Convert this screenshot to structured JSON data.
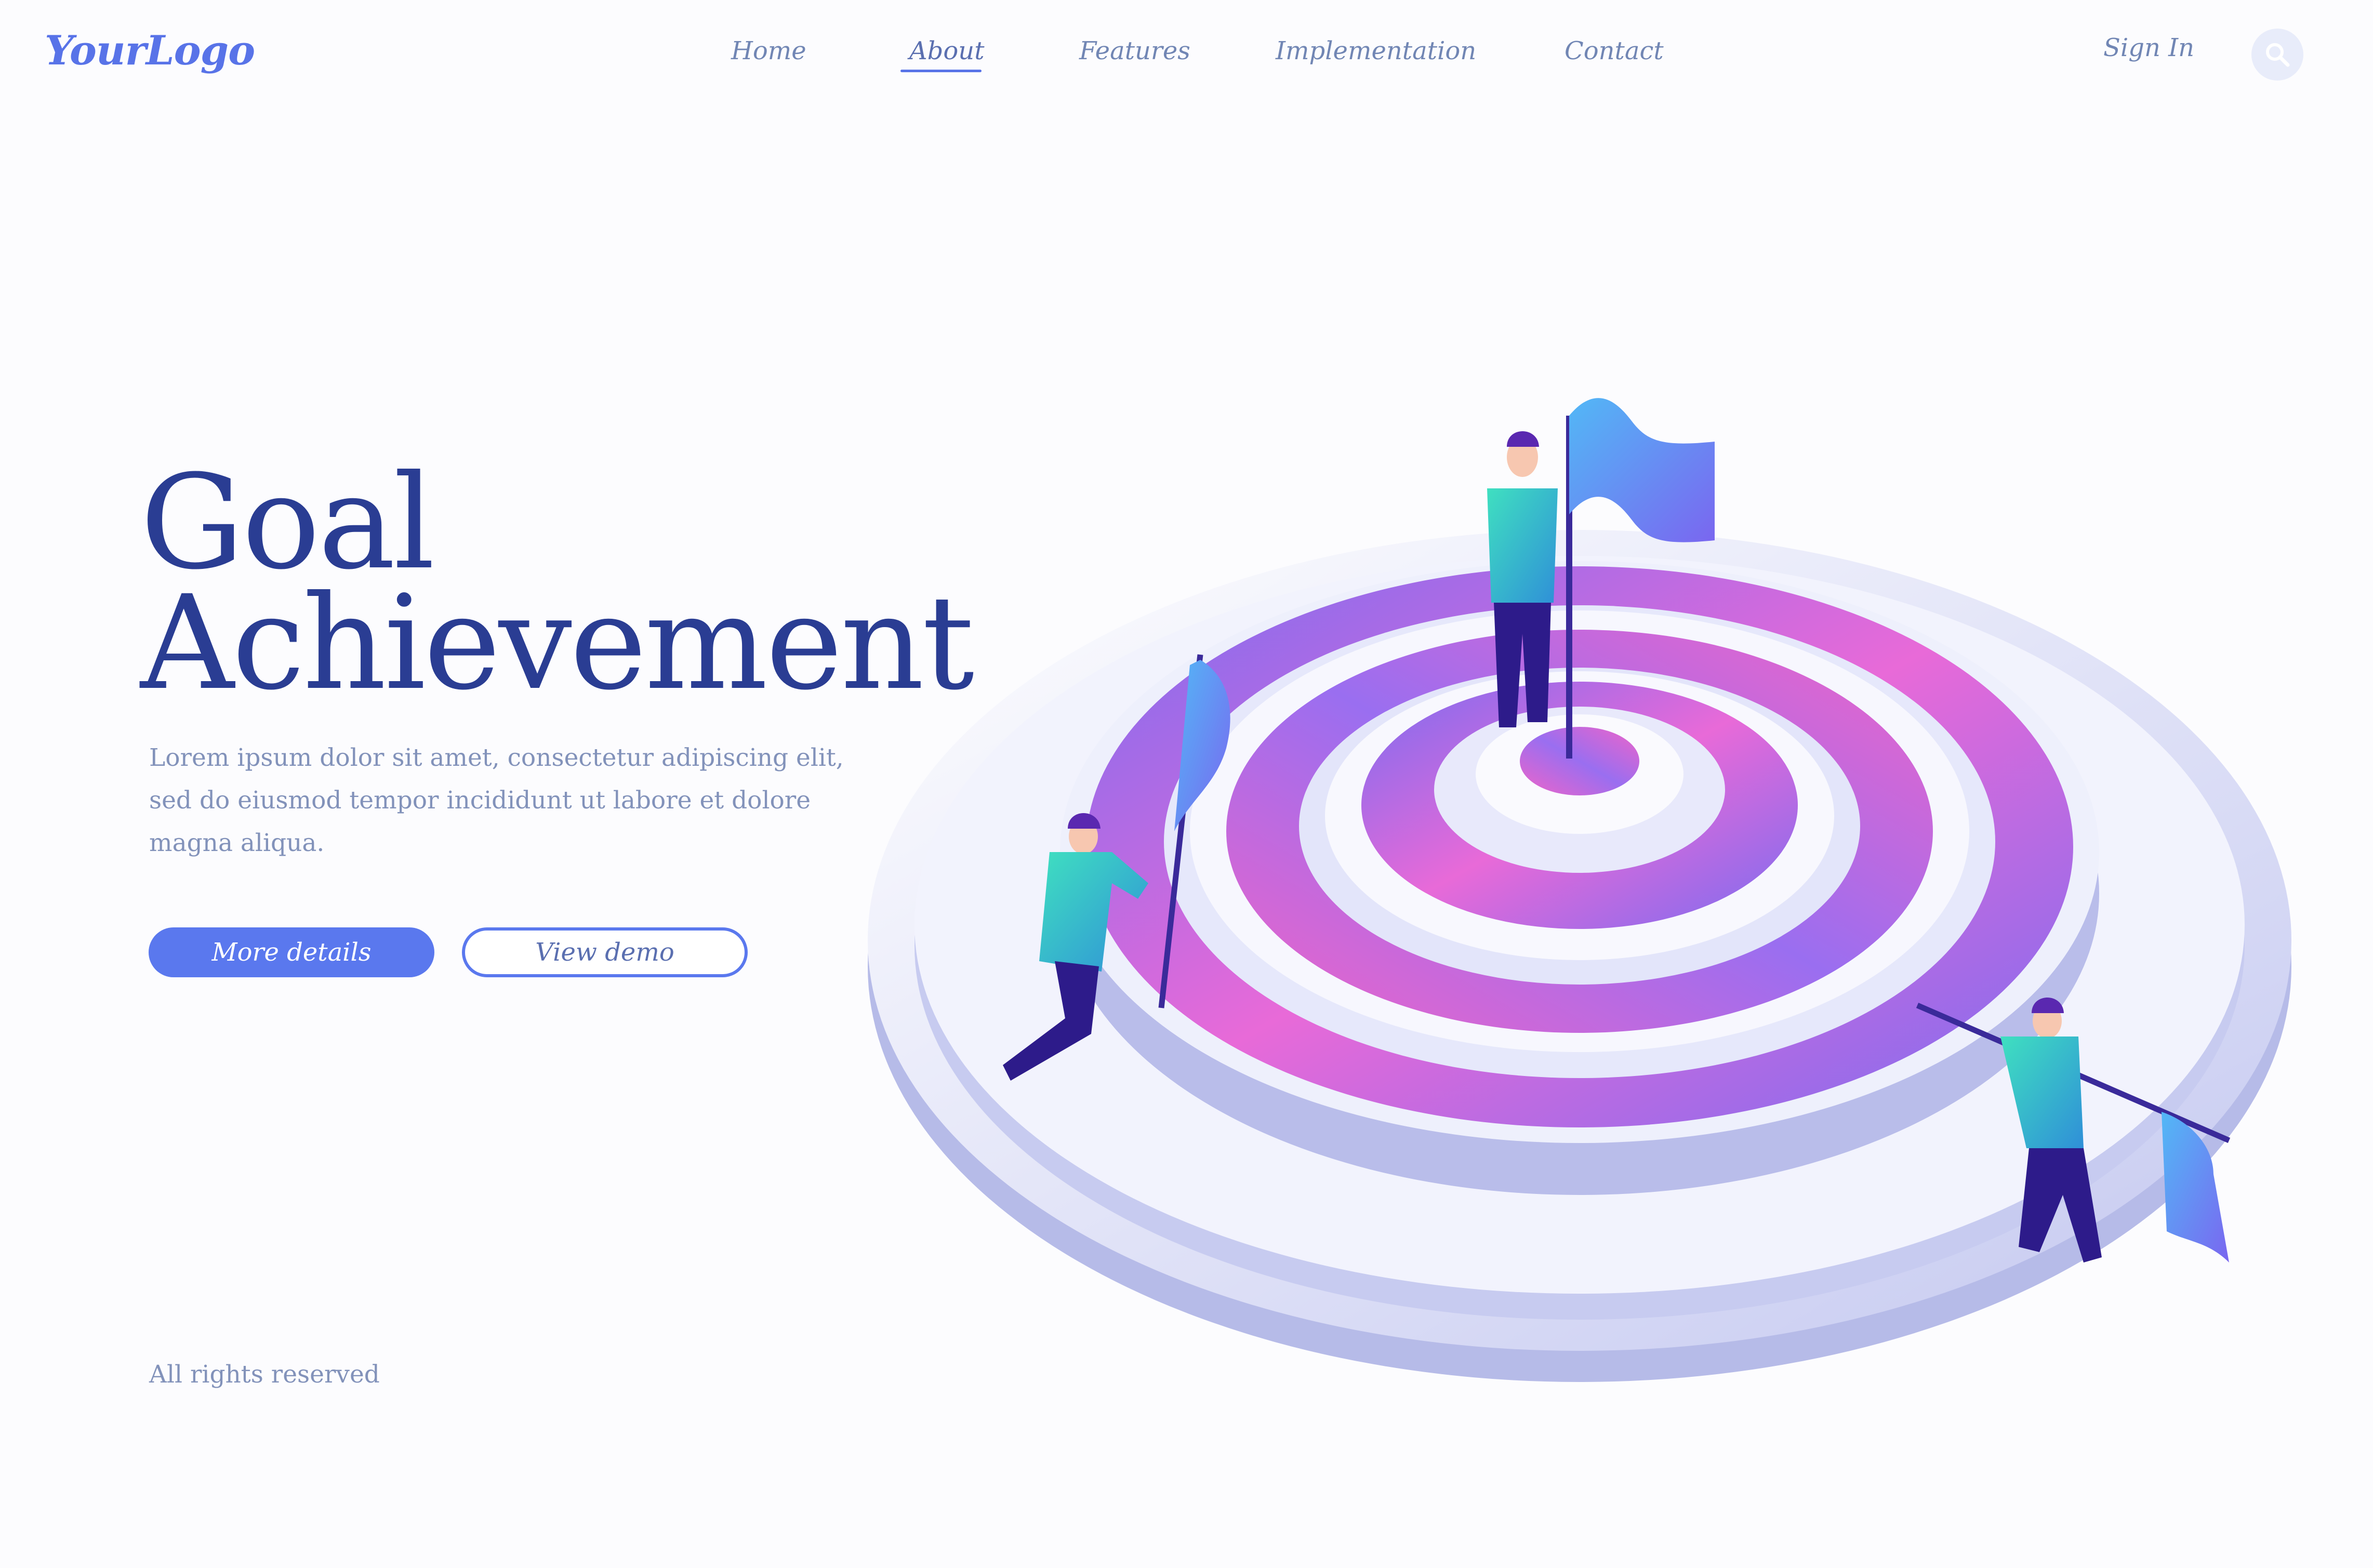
{
  "header": {
    "logo": "YourLogo",
    "nav": [
      {
        "label": "Home",
        "active": false
      },
      {
        "label": "About",
        "active": true
      },
      {
        "label": "Features",
        "active": false
      },
      {
        "label": "Implementation",
        "active": false
      },
      {
        "label": "Contact",
        "active": false
      }
    ],
    "sign_in": "Sign In",
    "search_icon": "search-icon"
  },
  "hero": {
    "title_line1": "Goal",
    "title_line2": "Achievement",
    "description_line1": "Lorem ipsum dolor sit amet, consectetur adipiscing elit,",
    "description_line2": "sed do eiusmod tempor incididunt ut labore et dolore",
    "description_line3": "magna aliqua.",
    "primary_button": "More details",
    "secondary_button": "View demo"
  },
  "footer": {
    "text": "All rights reserved"
  },
  "colors": {
    "accent": "#5a78ee",
    "title": "#2a3d93",
    "text_muted": "#8292ba",
    "target_gradient_a": "#f064c8",
    "target_gradient_b": "#7a6cf0"
  }
}
